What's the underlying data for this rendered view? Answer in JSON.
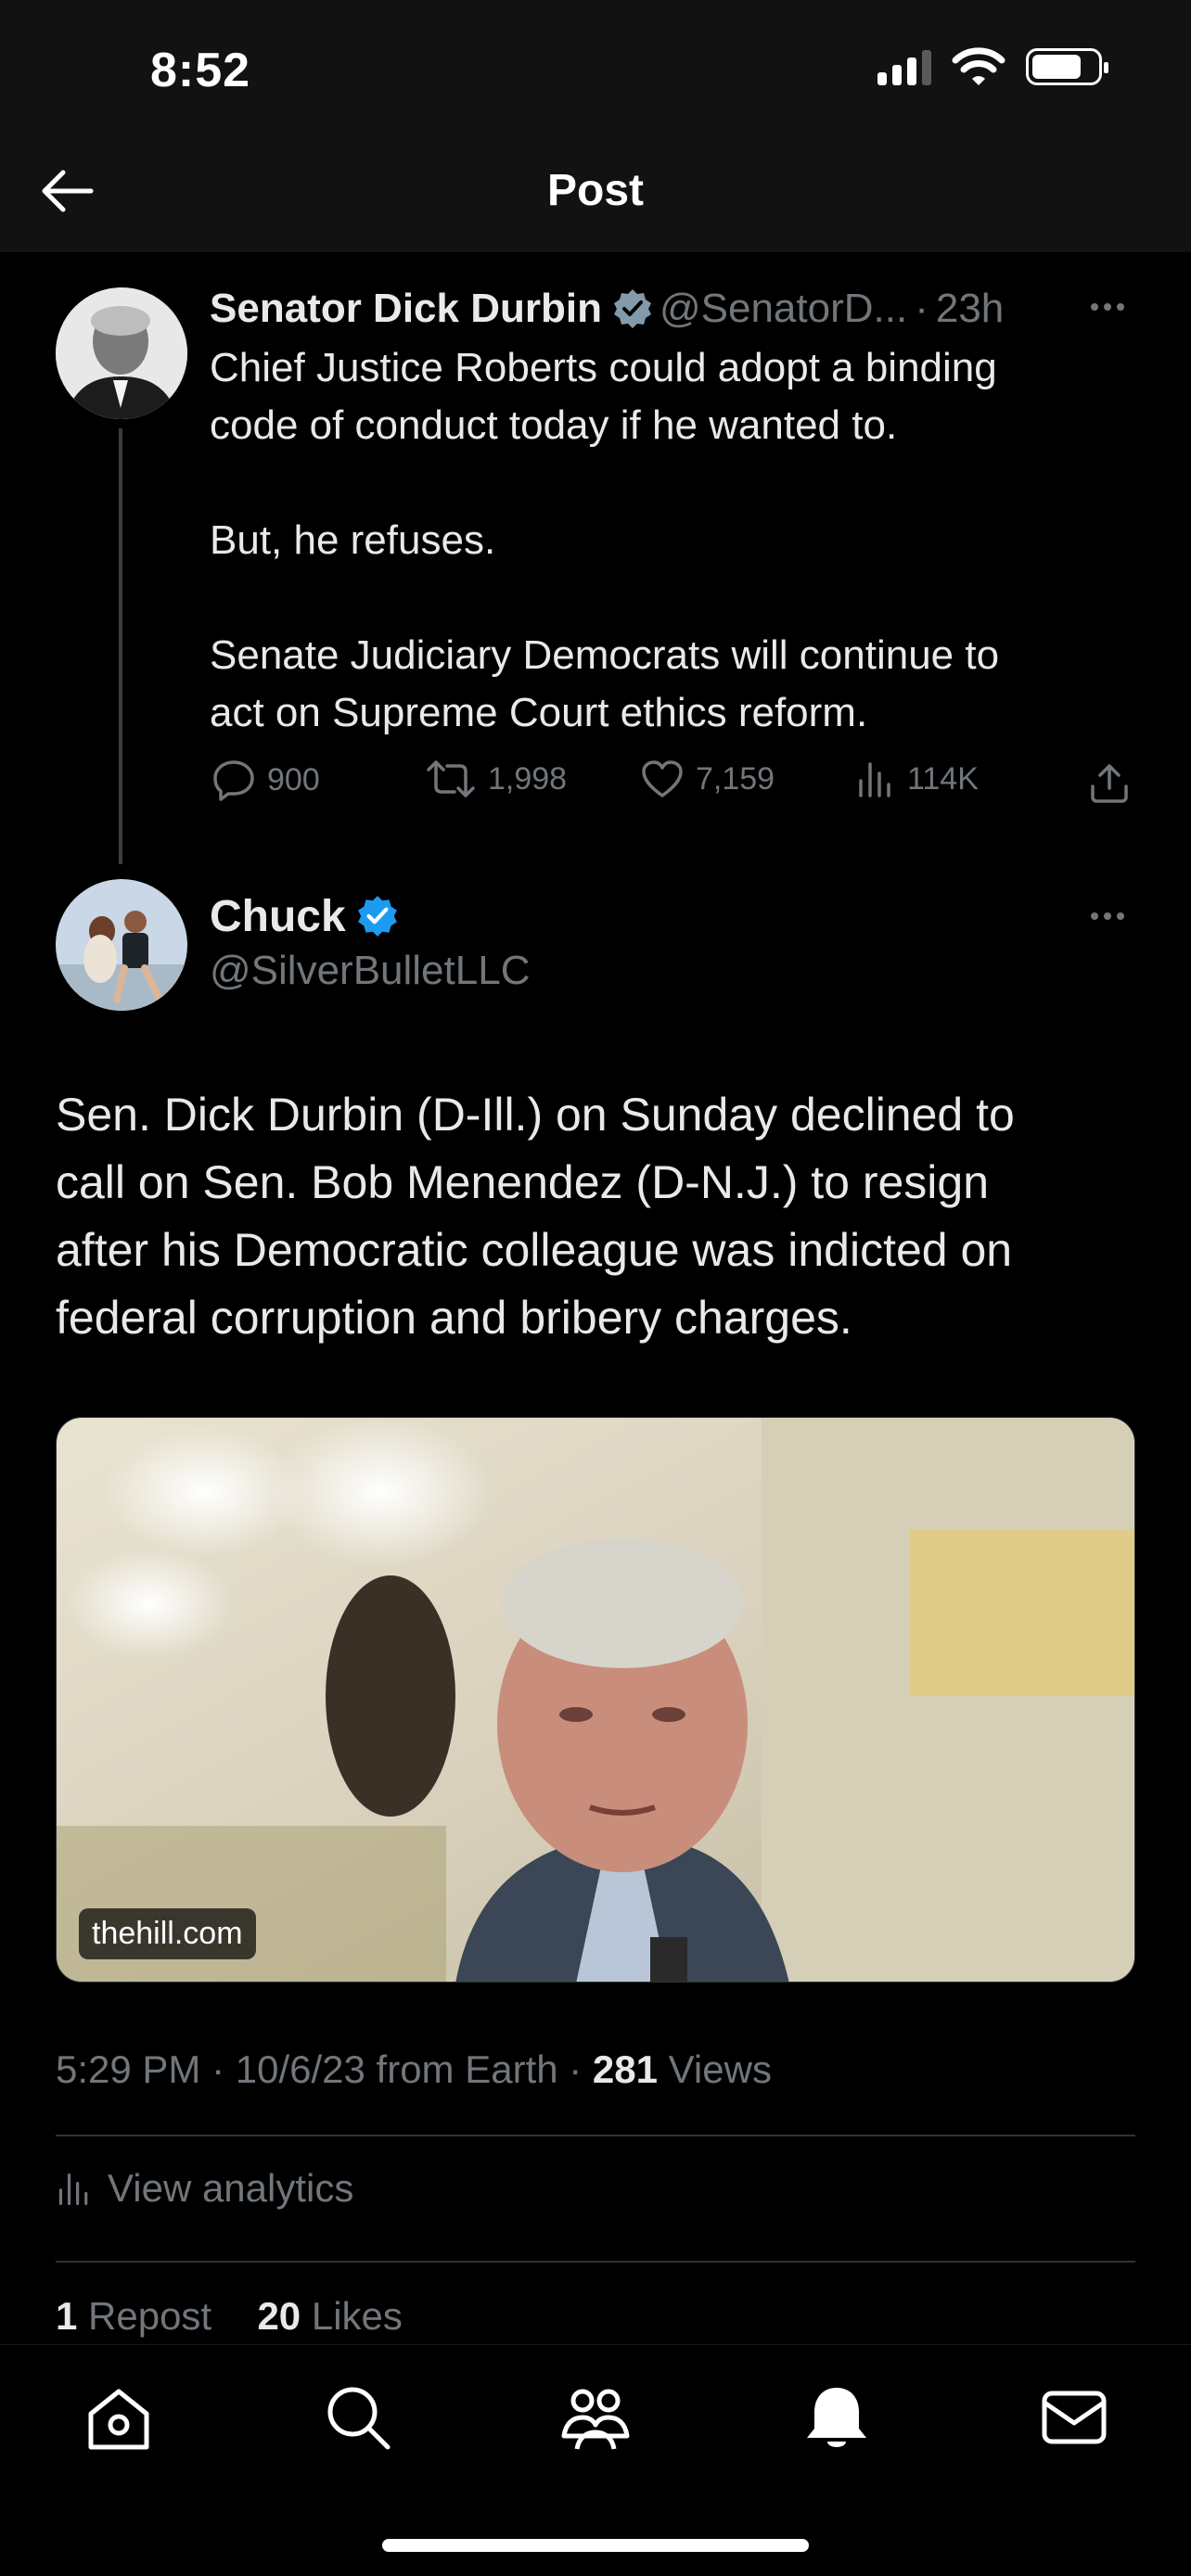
{
  "status_bar": {
    "time": "8:52"
  },
  "header": {
    "title": "Post"
  },
  "parent_tweet": {
    "author_name": "Senator Dick Durbin",
    "handle": "@SenatorD...",
    "separator": "·",
    "time_ago": "23h",
    "text": "Chief Justice Roberts could adopt a binding\ncode of conduct today if he wanted to.\n\nBut, he refuses.\n\nSenate Judiciary Democrats will continue to\nact on Supreme Court ethics reform.",
    "replies": "900",
    "reposts": "1,998",
    "likes": "7,159",
    "views": "114K"
  },
  "main_tweet": {
    "author_name": "Chuck",
    "handle": "@SilverBulletLLC",
    "text": "Sen. Dick Durbin (D-Ill.) on Sunday declined to\ncall on Sen. Bob Menendez (D-N.J.) to resign\nafter his Democratic colleague was indicted on\nfederal corruption and bribery charges.",
    "link_domain": "thehill.com",
    "meta_time": "5:29 PM · 10/6/23 from Earth · ",
    "views_count": "281",
    "views_label": " Views",
    "analytics_label": "View analytics",
    "repost_count": "1",
    "repost_label": " Repost",
    "likes_count": "20",
    "likes_label": " Likes"
  },
  "colors": {
    "background": "#000000",
    "header_background": "#121212",
    "text": "#e7e9ea",
    "secondary_text": "#71767b",
    "verified_blue": "#1d9bf0",
    "verified_gray": "#829aab"
  },
  "tab_bar": {
    "icons": [
      "home-icon",
      "search-icon",
      "communities-icon",
      "notifications-icon",
      "messages-icon"
    ]
  }
}
